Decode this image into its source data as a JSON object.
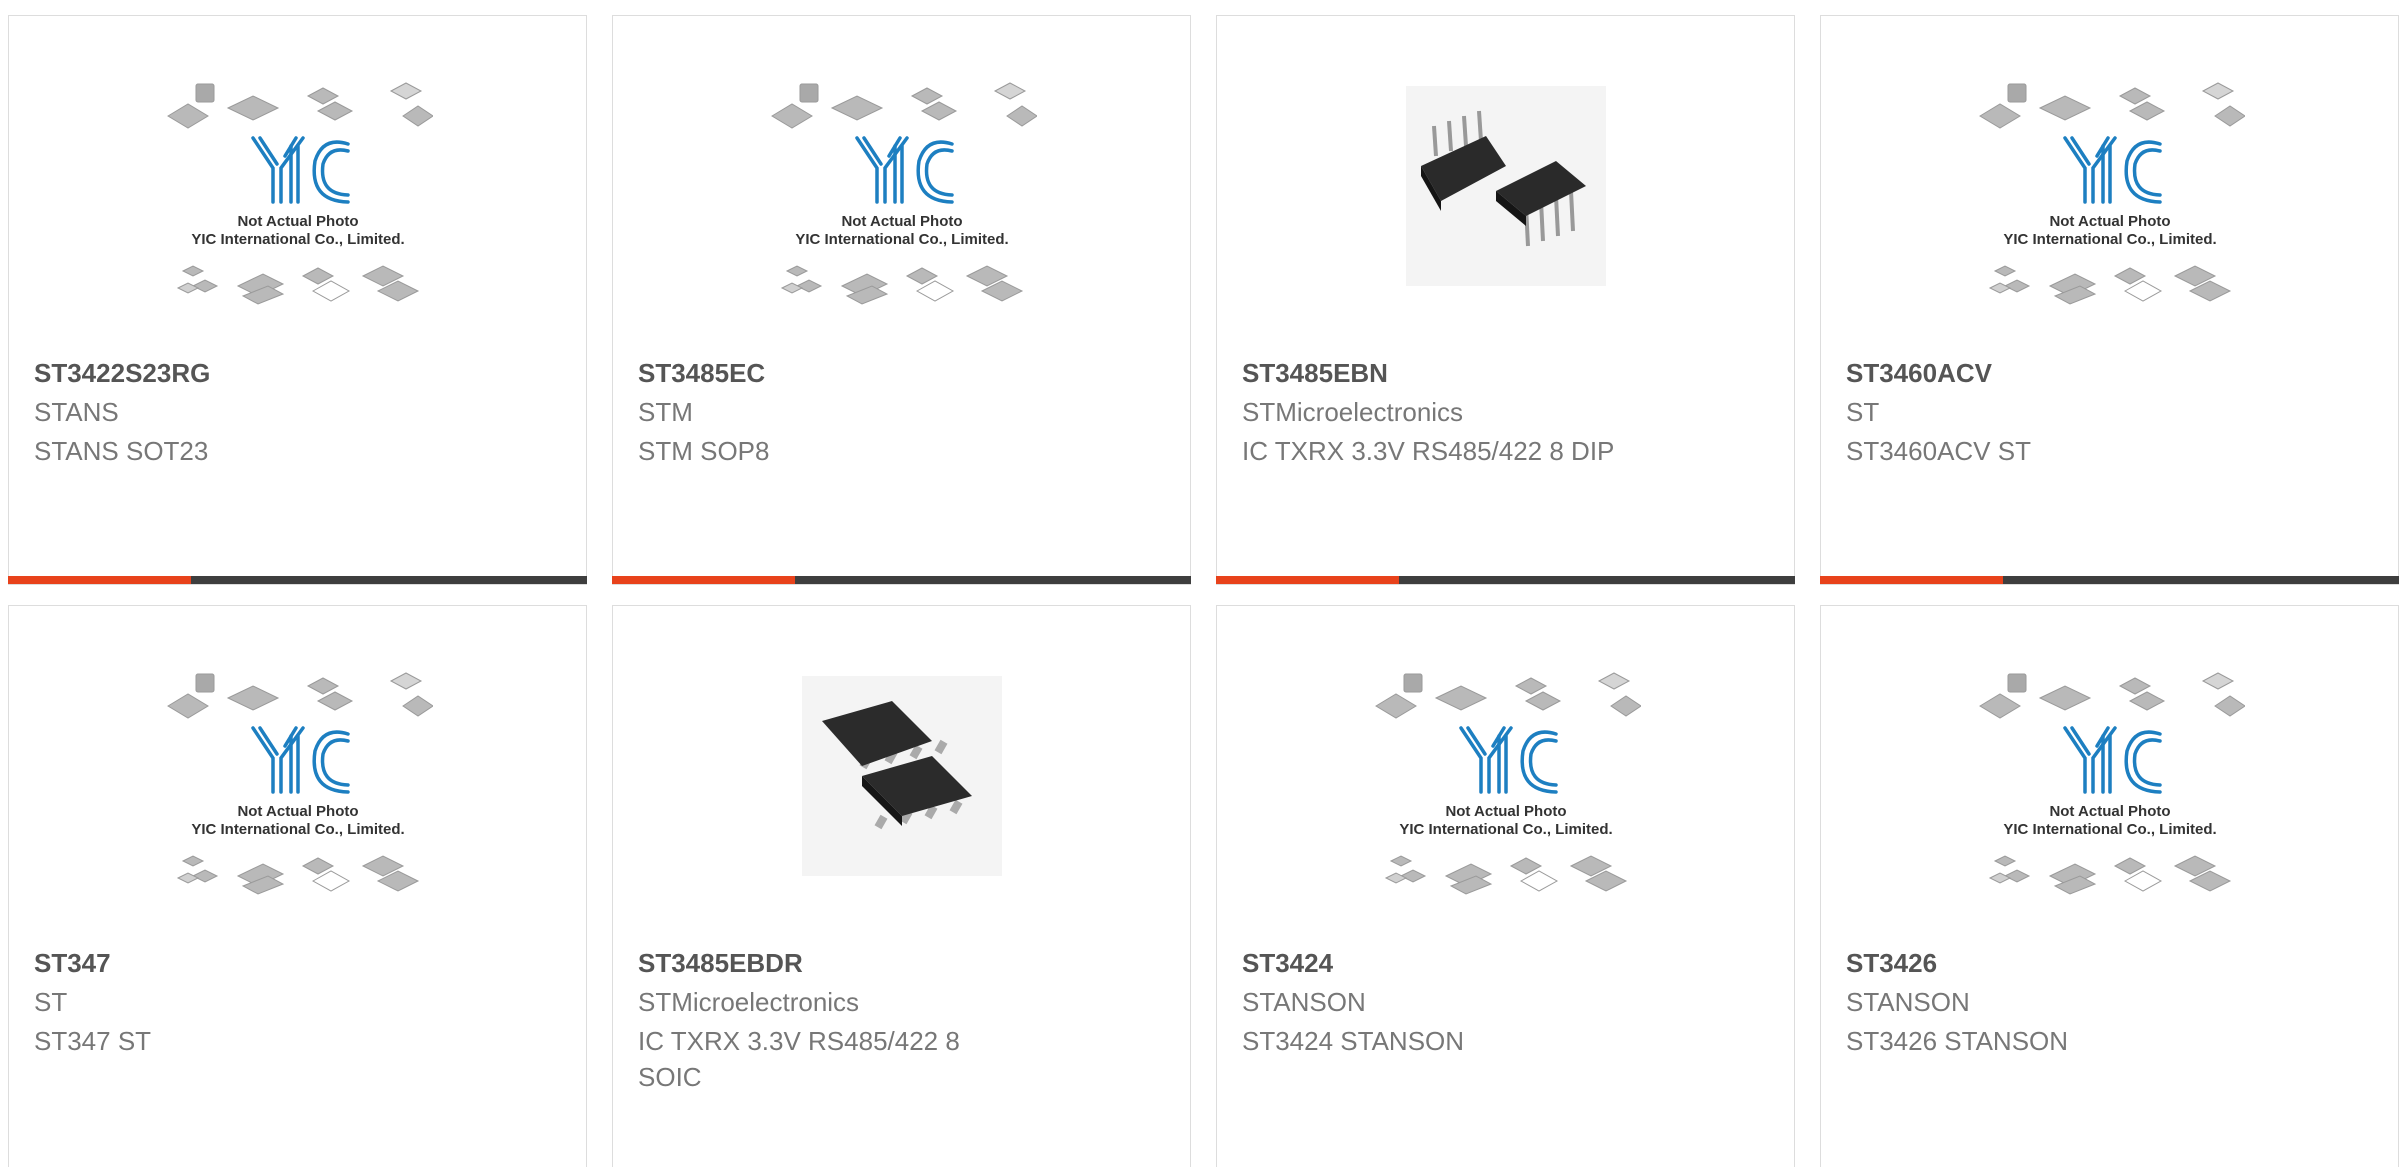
{
  "accent_color": "#e8421b",
  "bar_color": "#3e3e3e",
  "placeholder": {
    "line1": "Not Actual Photo",
    "line2": "YIC International Co., Limited.",
    "logo": "YIC"
  },
  "products": [
    {
      "part": "ST3422S23RG",
      "brand": "STANS",
      "desc": "STANS SOT23",
      "image": "placeholder"
    },
    {
      "part": "ST3485EC",
      "brand": "STM",
      "desc": "STM SOP8",
      "image": "placeholder"
    },
    {
      "part": "ST3485EBN",
      "brand": "STMicroelectronics",
      "desc": "IC TXRX 3.3V RS485/422 8 DIP",
      "image": "dip8-photo"
    },
    {
      "part": "ST3460ACV",
      "brand": "ST",
      "desc": "ST3460ACV ST",
      "image": "placeholder"
    },
    {
      "part": "ST347",
      "brand": "ST",
      "desc": "ST347 ST",
      "image": "placeholder"
    },
    {
      "part": "ST3485EBDR",
      "brand": "STMicroelectronics",
      "desc": "IC TXRX 3.3V RS485/422 8 SOIC",
      "image": "soic8-photo"
    },
    {
      "part": "ST3424",
      "brand": "STANSON",
      "desc": "ST3424 STANSON",
      "image": "placeholder"
    },
    {
      "part": "ST3426",
      "brand": "STANSON",
      "desc": "ST3426 STANSON",
      "image": "placeholder"
    }
  ]
}
